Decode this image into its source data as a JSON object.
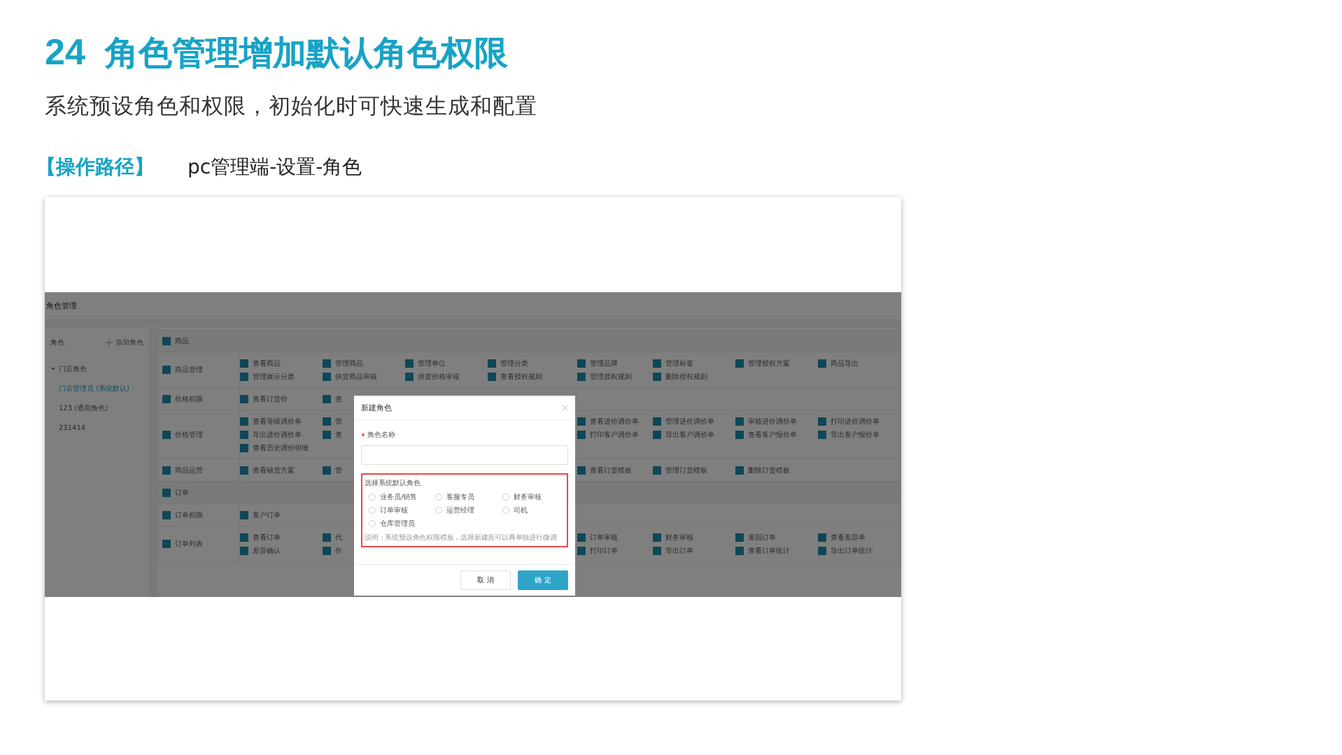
{
  "slide": {
    "number": "24",
    "title": "角色管理增加默认角色权限",
    "subtitle": "系统预设角色和权限，初始化时可快速生成和配置",
    "path_label": "【操作路径】",
    "path": "pc管理端-设置-角色"
  },
  "app": {
    "header": "角色管理",
    "sidebar": {
      "heading": "角色",
      "add_button": "添加角色",
      "tree": [
        {
          "label": "门店角色",
          "expanded": true,
          "selected": false,
          "children": [
            {
              "label": "门店管理员 (系统默认)",
              "selected": true
            },
            {
              "label": "123 (通用角色)",
              "selected": false
            },
            {
              "label": "231414",
              "selected": false
            }
          ]
        }
      ]
    },
    "permissions": [
      {
        "kind": "section",
        "label": "商品",
        "checked": true
      },
      {
        "kind": "group",
        "label": "商品管理",
        "checked": true,
        "lines": [
          {
            "left": [
              {
                "label": "查看商品",
                "checked": true
              },
              {
                "label": "管理商品",
                "checked": true
              },
              {
                "label": "管理单位",
                "checked": true
              },
              {
                "label": "管理分类",
                "checked": true
              }
            ],
            "right": [
              {
                "label": "管理品牌",
                "checked": true
              },
              {
                "label": "管理标签",
                "checked": true
              },
              {
                "label": "管理授权方案",
                "checked": true
              },
              {
                "label": "商品导出",
                "checked": true
              }
            ]
          },
          {
            "left": [
              {
                "label": "管理展示分类",
                "checked": true
              },
              {
                "label": "供货商品审核",
                "checked": true
              },
              {
                "label": "供货价格审核",
                "checked": true
              },
              {
                "label": "查看授权规则",
                "checked": true
              }
            ],
            "right": [
              {
                "label": "管理授权规则",
                "checked": true
              },
              {
                "label": "删除授权规则",
                "checked": true
              }
            ]
          }
        ]
      },
      {
        "kind": "group",
        "label": "价格权限",
        "checked": true,
        "lines": [
          {
            "left": [
              {
                "label": "查看订货价",
                "checked": true
              },
              {
                "label": "查",
                "checked": true
              }
            ]
          }
        ]
      },
      {
        "kind": "group",
        "label": "价格管理",
        "checked": true,
        "lines": [
          {
            "left": [
              {
                "label": "查看等级调价单",
                "checked": true
              },
              {
                "label": "管",
                "checked": true
              }
            ],
            "right": [
              {
                "label": "查看进价调价单",
                "checked": true
              },
              {
                "label": "管理进价调价单",
                "checked": true
              },
              {
                "label": "审核进价调价单",
                "checked": true
              },
              {
                "label": "打印进价调价单",
                "checked": true
              }
            ]
          },
          {
            "left": [
              {
                "label": "导出进价调价单",
                "checked": true
              },
              {
                "label": "查",
                "checked": true
              }
            ],
            "right": [
              {
                "label": "打印客户调价单",
                "checked": true
              },
              {
                "label": "导出客户调价单",
                "checked": true
              },
              {
                "label": "查看客户报价单",
                "checked": true
              },
              {
                "label": "导出客户报价单",
                "checked": true
              }
            ]
          },
          {
            "left": [
              {
                "label": "查看历史调价明细",
                "checked": true
              }
            ]
          }
        ]
      },
      {
        "kind": "group",
        "label": "商品运营",
        "checked": true,
        "lines": [
          {
            "left": [
              {
                "label": "查看铺货方案",
                "checked": true
              },
              {
                "label": "管",
                "checked": true
              }
            ],
            "right": [
              {
                "label": "查看订货模板",
                "checked": true
              },
              {
                "label": "管理订货模板",
                "checked": true
              },
              {
                "label": "删除订货模板",
                "checked": true
              }
            ]
          }
        ]
      },
      {
        "kind": "section",
        "label": "订单",
        "checked": true
      },
      {
        "kind": "group",
        "label": "订单权限",
        "checked": true,
        "lines": [
          {
            "left": [
              {
                "label": "客户订单",
                "checked": true
              }
            ]
          }
        ]
      },
      {
        "kind": "group",
        "label": "订单列表",
        "checked": true,
        "lines": [
          {
            "left": [
              {
                "label": "查看订单",
                "checked": true
              },
              {
                "label": "代",
                "checked": true
              }
            ],
            "right": [
              {
                "label": "订单审核",
                "checked": true
              },
              {
                "label": "财务审核",
                "checked": true
              },
              {
                "label": "退回订单",
                "checked": true
              },
              {
                "label": "查看差异单",
                "checked": true
              }
            ]
          },
          {
            "left": [
              {
                "label": "差异确认",
                "checked": true
              },
              {
                "label": "作",
                "checked": true
              }
            ],
            "right": [
              {
                "label": "打印订单",
                "checked": true
              },
              {
                "label": "导出订单",
                "checked": true
              },
              {
                "label": "查看订单统计",
                "checked": true
              },
              {
                "label": "导出订单统计",
                "checked": true
              }
            ]
          }
        ]
      }
    ],
    "dialog": {
      "title": "新建角色",
      "name_label": "角色名称",
      "name_required": true,
      "preset_label": "选择系统默认角色",
      "presets": [
        {
          "label": "业务员/销售",
          "selected": false
        },
        {
          "label": "客服专员",
          "selected": false
        },
        {
          "label": "财务审核",
          "selected": false
        },
        {
          "label": "订单审核",
          "selected": false
        },
        {
          "label": "运营经理",
          "selected": false
        },
        {
          "label": "司机",
          "selected": false
        },
        {
          "label": "仓库管理员",
          "selected": false
        }
      ],
      "note": "说明：系统预设角色权限模板，选择新建后可以再单独进行微调",
      "buttons": [
        {
          "label": "取 消",
          "kind": "secondary"
        },
        {
          "label": "确 定",
          "kind": "primary"
        }
      ]
    }
  }
}
